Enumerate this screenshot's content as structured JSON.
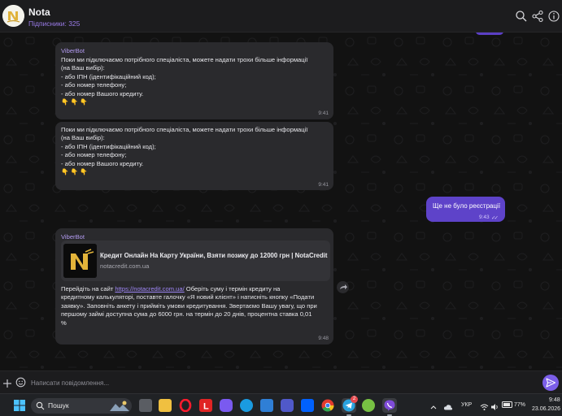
{
  "header": {
    "channel_name": "Nota",
    "subscribers": "Підписники: 325",
    "icons": [
      "search-icon",
      "share-icon",
      "info-icon"
    ]
  },
  "messages": [
    {
      "sender": "ViberBot",
      "text": "Поки ми підключаємо потрібного спеціаліста, можете надати трохи більше інформації\n(на Ваш вибір):\n- або ІПН (ідентифікаційний код);\n- або номер телефону;\n- або номер Вашого кредиту.\n👇 👇 👇",
      "time": "9:41"
    },
    {
      "text": "Поки ми підключаємо потрібного спеціаліста, можете надати трохи більше інформації\n(на Ваш вибір):\n- або ІПН (ідентифікаційний код);\n- або номер телефону;\n- або номер Вашого кредиту.\n👇 👇 👇",
      "time": "9:41"
    }
  ],
  "outgoing": {
    "text": "Ще не було реєстрації",
    "time": "9:43"
  },
  "link_message": {
    "sender": "ViberBot",
    "preview_title": "Кредит Онлайн На Карту України, Взяти позику до 12000 грн | NotaCredit",
    "preview_domain": "notacredit.com.ua",
    "text_before": "Перейдіть на сайт ",
    "link": "https://notacredit.com.ua/",
    "text_after": " Оберіть суму і термін кредиту на\nкредитному калькуляторі, поставте галочку «Я новий клієнт» і натисніть кнопку «Подати\nзаявку». Заповніть анкету і прийміть умови кредитування. Звертаємо Вашу увагу, що при\nпершому займі доступна сума до 6000 грн. на термін до 20 днів, процентна ставка 0,01\n%",
    "time": "9:48"
  },
  "composer": {
    "placeholder": "Написати повідомлення..."
  },
  "taskbar": {
    "search_label": "Пошук",
    "language": "УКР",
    "battery": "77%",
    "time": "9:48",
    "date": "23.06.2026",
    "telegram_badge": "2",
    "apps": [
      "windows-start-icon",
      "task-view-icon",
      "file-explorer-icon",
      "opera-icon",
      "l-app-icon",
      "copilot-icon",
      "edge-icon",
      "store-icon",
      "teams-icon",
      "dropbox-icon",
      "chrome-icon",
      "telegram-icon",
      "torrent-icon",
      "viber-icon"
    ]
  },
  "colors": {
    "accent": "#7b5ee8",
    "outgoing_bubble": "#5e43c9",
    "incoming_bubble": "#2a2a2d",
    "sender_name": "#b49cf3",
    "background": "#121212"
  }
}
